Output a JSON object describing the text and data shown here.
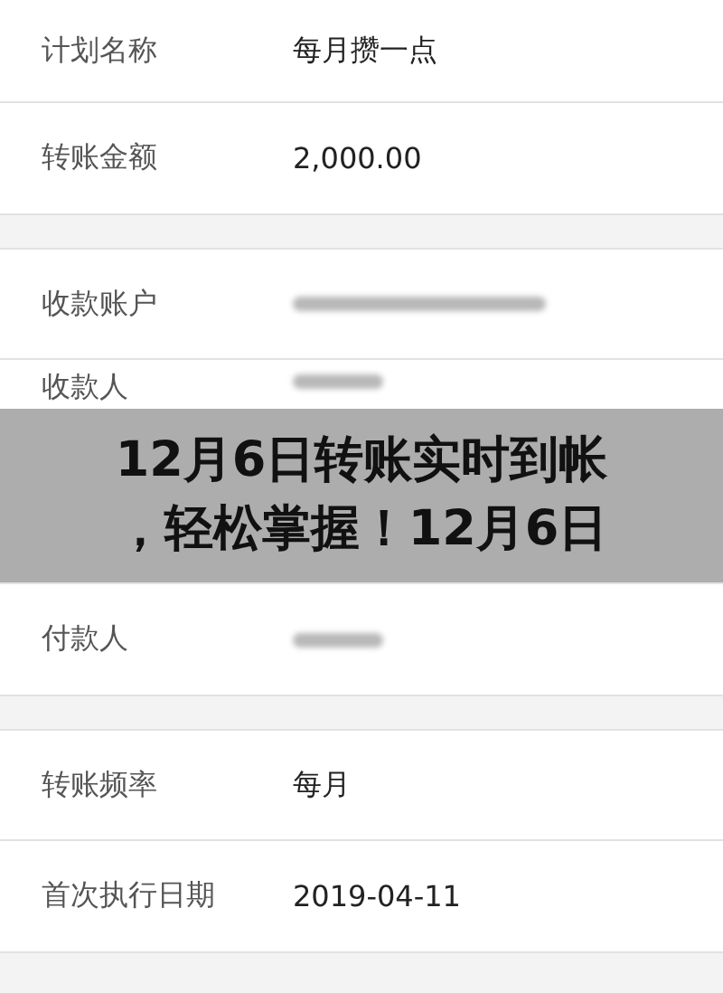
{
  "sections": [
    {
      "rows": [
        {
          "label": "计划名称",
          "value": "每月攒一点",
          "kind": "text"
        },
        {
          "label": "转账金额",
          "value": "2,000.00",
          "kind": "text"
        }
      ]
    },
    {
      "rows": [
        {
          "label": "收款账户",
          "kind": "redacted"
        },
        {
          "label": "收款人",
          "kind": "redacted"
        },
        {
          "kind": "blank"
        },
        {
          "label": "付款人",
          "kind": "redacted"
        }
      ]
    },
    {
      "rows": [
        {
          "label": "转账频率",
          "value": "每月",
          "kind": "text"
        },
        {
          "label": "首次执行日期",
          "value": "2019-04-11",
          "kind": "text"
        }
      ]
    }
  ],
  "banner": {
    "lines": [
      "12月6日转账实时到帐",
      "，轻松掌握！12月6日"
    ]
  }
}
